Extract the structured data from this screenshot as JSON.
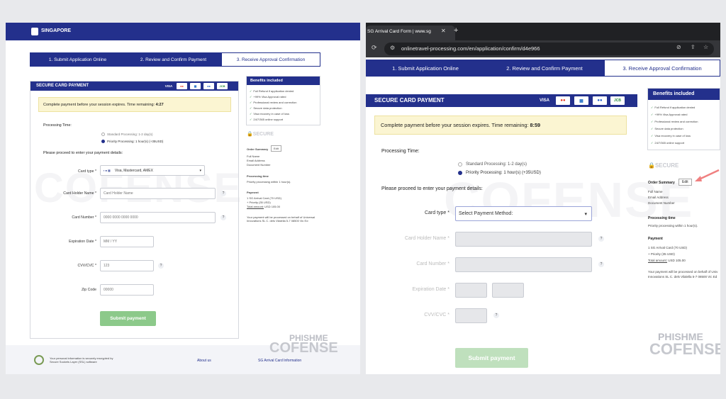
{
  "left": {
    "logo": "SINGAPORE",
    "steps": [
      "1. Submit Application Online",
      "2. Review and Confirm Payment",
      "3. Receive Approval Confirmation"
    ],
    "card_header": "SECURE CARD PAYMENT",
    "card_brands": [
      "VISA",
      "MC",
      "AMEX",
      "MAES",
      "JCB"
    ],
    "timer_prefix": "Complete payment before your session expires. Time remaining:",
    "timer_value": "4:27",
    "processing_label": "Processing Time:",
    "standard": "Standard Processing: 1-2 day(s)",
    "priority": "Priority Processing: 1 hour(s) (+35USD)",
    "proceed": "Please proceed to enter your payment details:",
    "card_type_label": "Card type *",
    "card_type_value": "Visa, Mastercard, AMEX",
    "holder_label": "Card Holder Name *",
    "holder_placeholder": "Card Holder Name",
    "number_label": "Card Number *",
    "number_placeholder": "0000 0000 0000 0000",
    "exp_label": "Expiration Date *",
    "exp_placeholder": "MM / YY",
    "cvv_label": "CVV/CVC *",
    "cvv_placeholder": "123",
    "zip_label": "Zip Code",
    "zip_placeholder": "00000",
    "submit": "Submit payment",
    "benefits_title": "Benefits included",
    "benefits": [
      "Full Refund if application denied",
      "+99% Visa Approval rated",
      "Professional review and correction",
      "Secure data protection",
      "Visa recovery in case of loss",
      "24/7/365 online support"
    ],
    "secure": "SECURE",
    "order_summary": "Order Summary",
    "edit": "Edit",
    "full_name": "Full Name",
    "email": "Email Address",
    "doc": "Document Number",
    "processing_time": "Processing time",
    "processing_time_val": "Priority processing within 1 hour(s).",
    "payment": "Payment",
    "pay1": "1 SG Arrival Card (70 USD)",
    "pay2": "+ Priority (35 USD)",
    "total_label": "Total amount:",
    "total_val": "USD 105.00",
    "behalf": "Your payment will be processed on behalf of Universal Innovations SL C. dels Vilalella 5-7 08500 Vic Ed",
    "footer_ssl": "Your personal information is securely encrypted by Secure Sockets Layer (SSL) software",
    "about": "About us",
    "sg_info": "SG Arrival Card Information",
    "brand1": "PHISHME",
    "brand2": "COFENSE"
  },
  "right": {
    "tab_title": "SG Arrival Card Form | www.sg",
    "url": "onlinetravel-processing.com/en/application/confirm/d4e966",
    "steps": [
      "1. Submit Application Online",
      "2. Review and Confirm Payment",
      "3. Receive Approval Confirmation"
    ],
    "card_header": "SECURE CARD PAYMENT",
    "card_brands": [
      "VISA",
      "MC",
      "AMEX",
      "MAES",
      "JCB"
    ],
    "timer_prefix": "Complete payment before your session expires. Time remaining:",
    "timer_value": "8:59",
    "processing_label": "Processing Time:",
    "standard": "Standard Processing: 1-2 day(s)",
    "priority": "Priority Processing: 1 hour(s) (+35USD)",
    "proceed": "Please proceed to enter your payment details:",
    "card_type_label": "Card type *",
    "card_type_value": "Select Payment Method:",
    "holder_label": "Card Holder Name *",
    "number_label": "Card Number *",
    "exp_label": "Expiration Date *",
    "cvv_label": "CVV/CVC *",
    "submit": "Submit payment",
    "benefits_title": "Benefits included",
    "benefits": [
      "Full Refund if application denied",
      "+99% Visa Approval rated",
      "Professional review and correction",
      "Secure data protection",
      "Visa recovery in case of loss",
      "24/7/365 online support"
    ],
    "secure": "SECURE",
    "order_summary": "Order Summary",
    "edit": "Edit",
    "full_name": "Full Name",
    "email": "Email Address",
    "doc": "Document Number",
    "processing_time": "Processing time",
    "processing_time_val": "Priority processing within 1 hour(s).",
    "payment": "Payment",
    "pay1": "1 SG Arrival Card (70 USD)",
    "pay2": "+ Priority (35 USD)",
    "total_label": "Total amount:",
    "total_val": "USD 105.00",
    "behalf": "Your payment will be processed on behalf of Univ Innovations SL C. dels Vilalella 5-7 08500 Vic Ed",
    "brand1": "PHISHME",
    "brand2": "COFENSE"
  }
}
